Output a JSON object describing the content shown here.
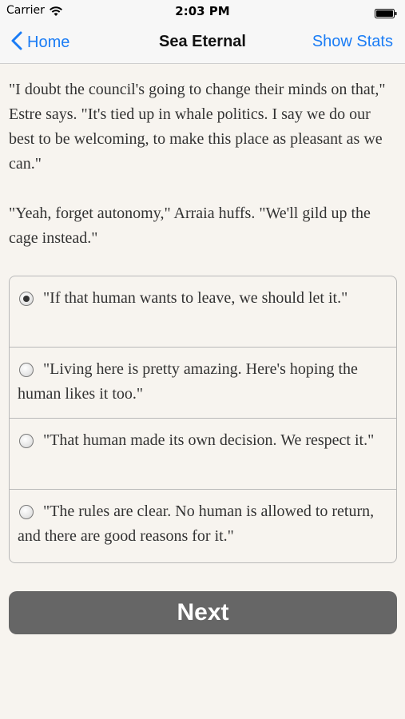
{
  "status_bar": {
    "carrier": "Carrier",
    "time": "2:03 PM",
    "wifi_icon": "wifi-icon",
    "battery_icon": "battery-icon"
  },
  "nav": {
    "back_label": "Home",
    "title": "Sea Eternal",
    "right_label": "Show Stats",
    "accent_color": "#1a7cf5"
  },
  "story": {
    "paragraphs": [
      "\"I doubt the council's going to change their minds on that,\" Estre says. \"It's tied up in whale politics. I say we do our best to be welcoming, to make this place as pleasant as we can.\"",
      "\"Yeah, forget autonomy,\" Arraia huffs. \"We'll gild up the cage instead.\""
    ]
  },
  "choices": [
    {
      "text": "\"If that human wants to leave, we should let it.\"",
      "selected": true
    },
    {
      "text": "\"Living here is pretty amazing. Here's hoping the human likes it too.\"",
      "selected": false
    },
    {
      "text": "\"That human made its own decision. We respect it.\"",
      "selected": false
    },
    {
      "text": "\"The rules are clear. No human is allowed to return, and there are good reasons for it.\"",
      "selected": false
    }
  ],
  "next_button": {
    "label": "Next",
    "color": "#666666"
  }
}
